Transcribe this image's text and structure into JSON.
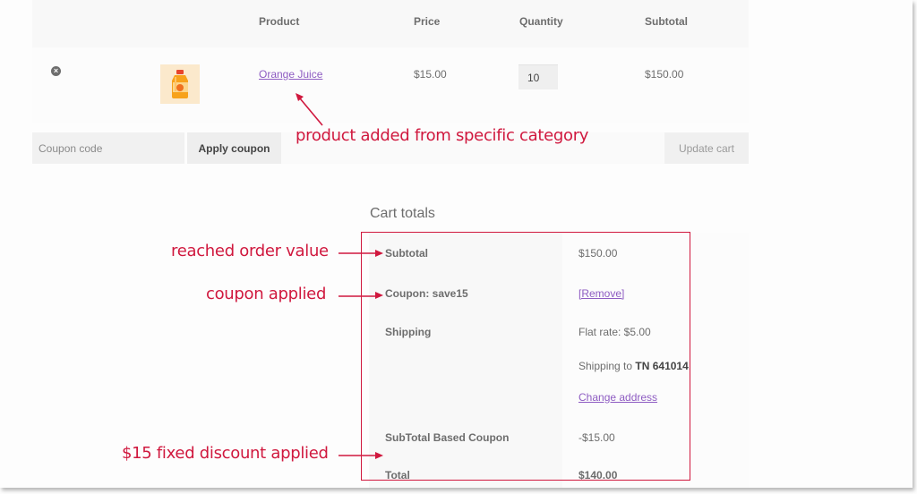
{
  "cart": {
    "headers": {
      "product": "Product",
      "price": "Price",
      "quantity": "Quantity",
      "subtotal": "Subtotal"
    },
    "items": [
      {
        "name": "Orange Juice",
        "price": "$15.00",
        "quantity": "10",
        "subtotal": "$150.00",
        "remove_icon": "remove-circle-icon",
        "thumbnail": "orange-juice-bottle"
      }
    ],
    "coupon_placeholder": "Coupon code",
    "apply_coupon_label": "Apply coupon",
    "update_cart_label": "Update cart"
  },
  "totals": {
    "title": "Cart totals",
    "subtotal_label": "Subtotal",
    "subtotal_value": "$150.00",
    "coupon_label": "Coupon: save15",
    "coupon_remove": "[Remove]",
    "shipping_label": "Shipping",
    "shipping_rate": "Flat rate: $5.00",
    "shipping_to_prefix": "Shipping to ",
    "shipping_to_location": "TN 641014",
    "shipping_to_suffix": ".",
    "change_address": "Change address",
    "discount_label": "SubTotal Based Coupon",
    "discount_value": "-$15.00",
    "total_label": "Total",
    "total_value": "$140.00"
  },
  "annotations": {
    "product_note": "product added from specific category",
    "order_value_note": "reached order value",
    "coupon_note": "coupon applied",
    "discount_note": "$15 fixed discount applied",
    "color": "#d0183e"
  }
}
